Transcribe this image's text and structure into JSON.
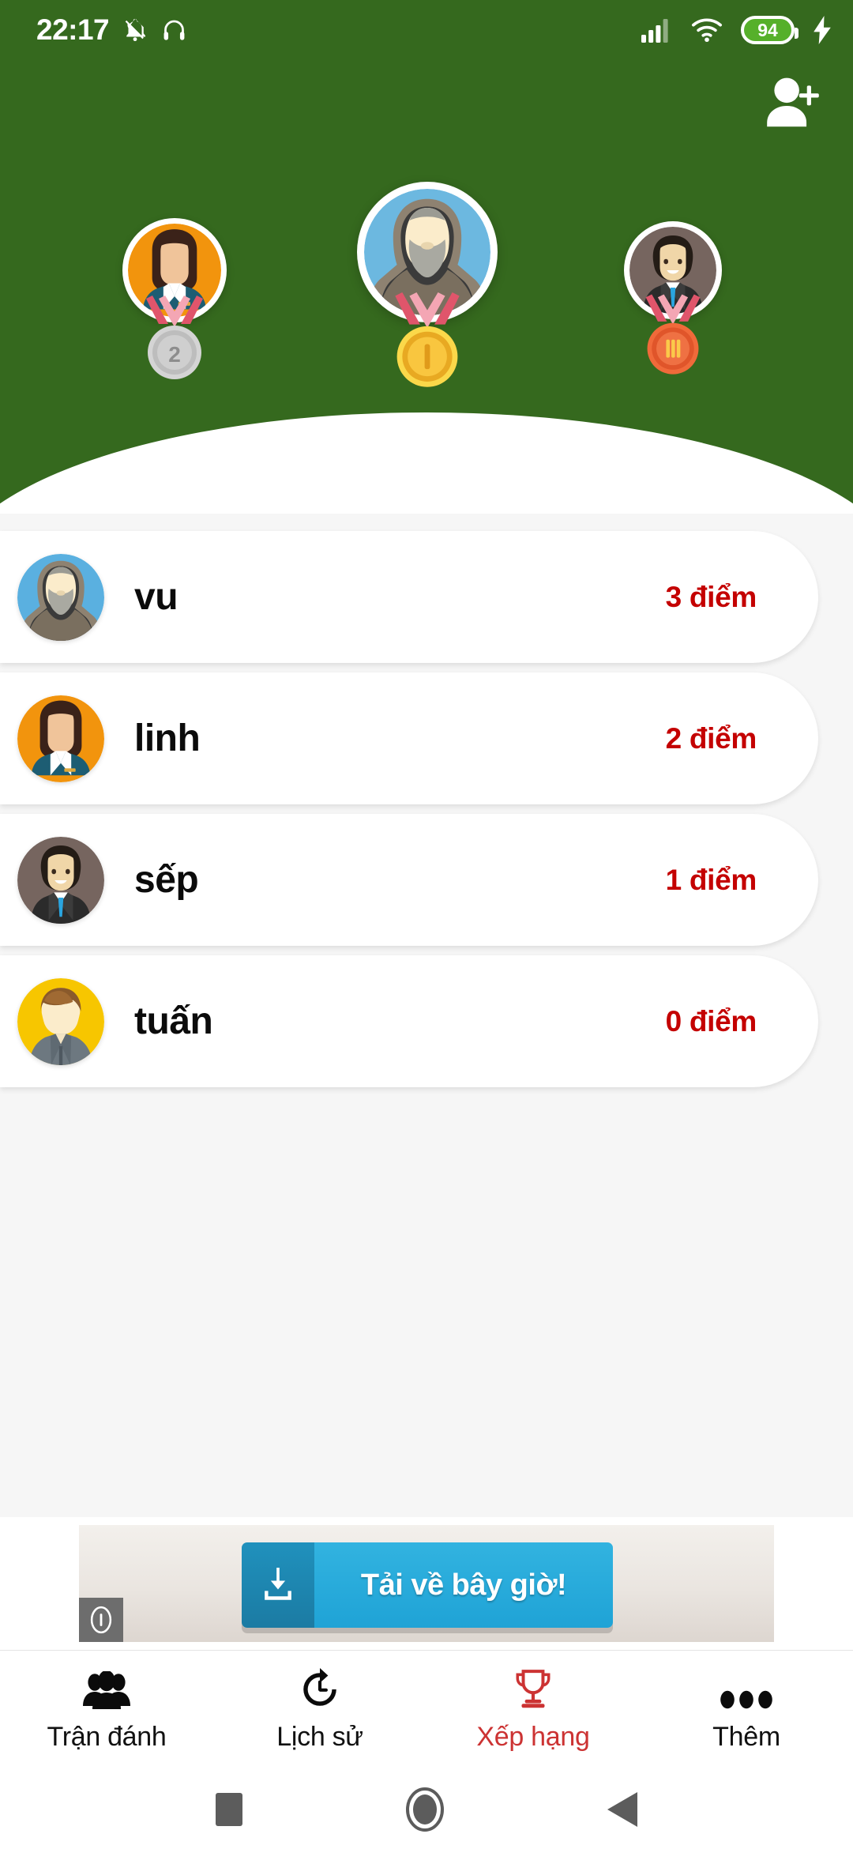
{
  "status_bar": {
    "time": "22:17",
    "battery_level": "94",
    "icons": [
      "silent-mode-icon",
      "headphones-icon",
      "cellular-signal-icon",
      "wifi-icon",
      "battery-icon",
      "charging-bolt-icon"
    ]
  },
  "header": {
    "background_color": "#35691e",
    "add_person_icon": "add-person-icon"
  },
  "podium": [
    {
      "rank": "2",
      "medal": "silver",
      "medal_numeral": "2",
      "avatar": "woman-orange",
      "avatar_bg": "#f2940d"
    },
    {
      "rank": "1",
      "medal": "gold",
      "medal_numeral": "I",
      "avatar": "hooded-man-blue",
      "avatar_bg": "#6cb8e0"
    },
    {
      "rank": "3",
      "medal": "bronze",
      "medal_numeral": "III",
      "avatar": "businessman-dark",
      "avatar_bg": "#76655f"
    }
  ],
  "leaderboard": {
    "score_color": "#c40000",
    "rows": [
      {
        "name": "vu",
        "score": "3 điểm",
        "avatar": "hooded-man-blue",
        "avatar_bg": "#5ab0e0"
      },
      {
        "name": "linh",
        "score": "2 điểm",
        "avatar": "woman-orange",
        "avatar_bg": "#f2940d"
      },
      {
        "name": "sếp",
        "score": "1 điểm",
        "avatar": "businessman-dark",
        "avatar_bg": "#76655f"
      },
      {
        "name": "tuấn",
        "score": "0 điểm",
        "avatar": "young-man-yellow",
        "avatar_bg": "#f7c600"
      }
    ]
  },
  "ad": {
    "button_label": "Tải về bây giờ!",
    "download_icon": "download-icon",
    "info_icon": "info-icon"
  },
  "bottom_nav": {
    "active_color": "#cc3333",
    "tabs": [
      {
        "label": "Trận đánh",
        "icon": "people-group-icon",
        "active": false
      },
      {
        "label": "Lịch sử",
        "icon": "history-clock-icon",
        "active": false
      },
      {
        "label": "Xếp hạng",
        "icon": "trophy-icon",
        "active": true
      },
      {
        "label": "Thêm",
        "icon": "more-dots-icon",
        "active": false
      }
    ]
  },
  "android_nav": {
    "buttons": [
      {
        "name": "recents-square-icon"
      },
      {
        "name": "home-circle-icon"
      },
      {
        "name": "back-triangle-icon"
      }
    ]
  }
}
